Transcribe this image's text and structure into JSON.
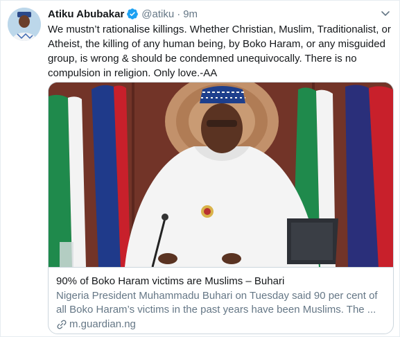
{
  "tweet": {
    "author_name": "Atiku Abubakar",
    "verified": true,
    "handle": "@atiku",
    "separator": "·",
    "time": "9m",
    "text": "We mustn’t rationalise killings. Whether Christian, Muslim, Traditionalist, or Atheist, the killing of any human being, by Boko Haram, or any misguided group, is wrong & should be condemned unequivocally. There is no compulsion in religion. Only love.-AA"
  },
  "card": {
    "title": "90% of Boko Haram victims are Muslims – Buhari",
    "description": "Nigeria President Muhammadu Buhari on Tuesday said 90 per cent of all Boko Haram’s victims in the past years have been Muslims. The ...",
    "domain": "m.guardian.ng"
  },
  "icons": {
    "verified": "verified-badge-icon",
    "caret": "chevron-down-icon",
    "link": "link-icon"
  },
  "colors": {
    "verified_blue": "#1da1f2",
    "secondary_text": "#657786",
    "border": "#ccd6dd"
  }
}
